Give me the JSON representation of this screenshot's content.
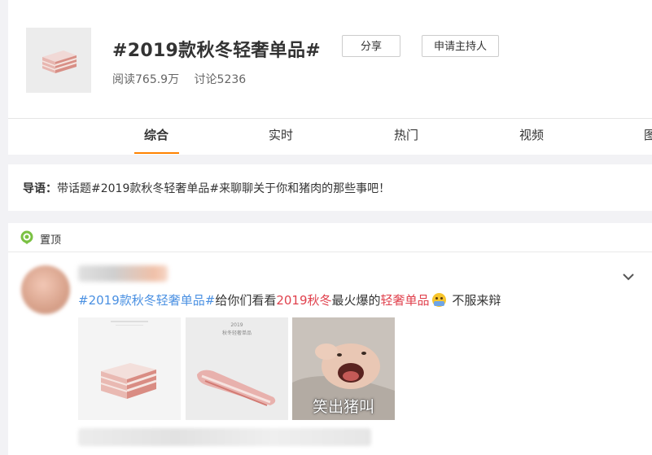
{
  "header": {
    "title": "#2019款秋冬轻奢单品#",
    "share_label": "分享",
    "host_label": "申请主持人",
    "reads_label": "阅读765.9万",
    "discussions_label": "讨论5236"
  },
  "tabs": [
    {
      "label": "综合",
      "active": true
    },
    {
      "label": "实时",
      "active": false
    },
    {
      "label": "热门",
      "active": false
    },
    {
      "label": "视频",
      "active": false
    },
    {
      "label": "图",
      "active": false
    }
  ],
  "intro": {
    "prefix": "导语：",
    "text": "带话题#2019款秋冬轻奢单品#来聊聊关于你和猪肉的那些事吧！"
  },
  "pinned": {
    "label": "置顶",
    "icon": "location-pin-icon"
  },
  "post": {
    "text_tag": "#2019款秋冬轻奢单品#",
    "text_mid1": "给你们看看",
    "text_red1": "2019秋冬",
    "text_mid2": "最火爆的",
    "text_red2": "轻奢单品",
    "text_end": "不服来辩",
    "images": [
      {
        "icon": "pork-belly-image"
      },
      {
        "icon": "pork-slice-image",
        "caption_small": "2019",
        "caption_small2": "秋冬轻奢单品"
      },
      {
        "icon": "laughing-pig-image",
        "caption": "笑出猪叫"
      }
    ]
  },
  "colors": {
    "accent_orange": "#ff8200",
    "hashtag_blue": "#4a90e2",
    "highlight_red": "#e0414d",
    "pin_green": "#7ac143"
  }
}
